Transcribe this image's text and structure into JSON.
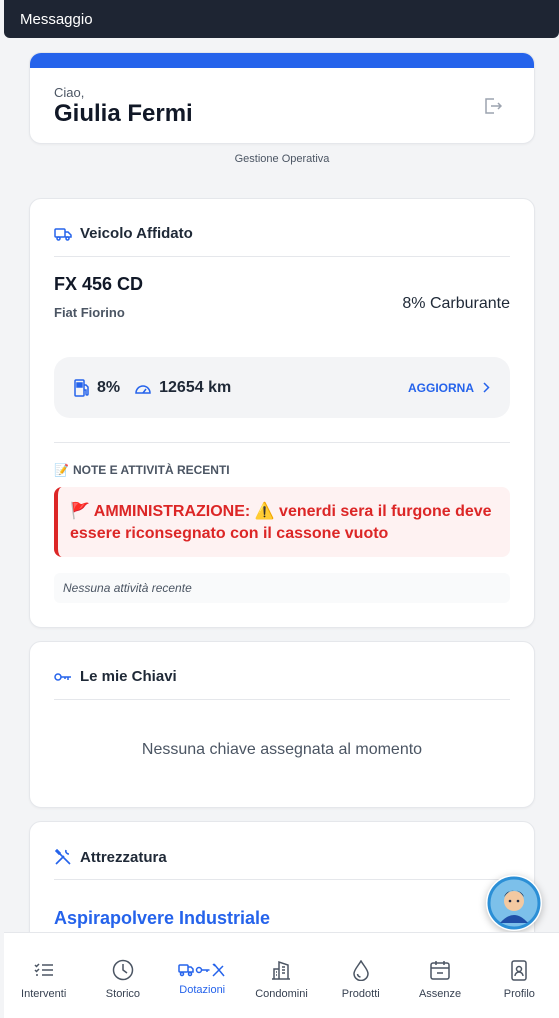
{
  "topbar": {
    "title": "Messaggio"
  },
  "hero": {
    "greeting": "Ciao,",
    "name": "Giulia Fermi"
  },
  "subtitle": "Gestione Operativa",
  "vehicle": {
    "title": "Veicolo Affidato",
    "plate": "FX 456 CD",
    "model": "Fiat Fiorino",
    "fuel_label": "8% Carburante",
    "fuel_pct": "8%",
    "km": "12654 km",
    "update_label": "AGGIORNA",
    "notes_title": "NOTE E ATTIVITÀ RECENTI",
    "notes_emoji": "📝",
    "alert_flag": "🚩",
    "alert_prefix": "AMMINISTRAZIONE:",
    "alert_warning": "⚠️",
    "alert_text": "venerdi sera il furgone deve essere riconsegnato con il cassone vuoto",
    "no_activity": "Nessuna attività recente"
  },
  "keys": {
    "title": "Le mie Chiavi",
    "empty": "Nessuna chiave assegnata al momento"
  },
  "tools": {
    "title": "Attrezzatura",
    "first_item": "Aspirapolvere Industriale"
  },
  "nav": {
    "items": [
      {
        "label": "Interventi",
        "icon": "list-icon"
      },
      {
        "label": "Storico",
        "icon": "clock-icon"
      },
      {
        "label": "Dotazioni",
        "icon": "equipment-icon",
        "active": true
      },
      {
        "label": "Condomini",
        "icon": "building-icon"
      },
      {
        "label": "Prodotti",
        "icon": "drop-icon"
      },
      {
        "label": "Assenze",
        "icon": "calendar-icon"
      },
      {
        "label": "Profilo",
        "icon": "badge-icon"
      }
    ]
  },
  "colors": {
    "accent": "#2563eb",
    "topbar": "#1e2533",
    "alert": "#dc2626"
  }
}
